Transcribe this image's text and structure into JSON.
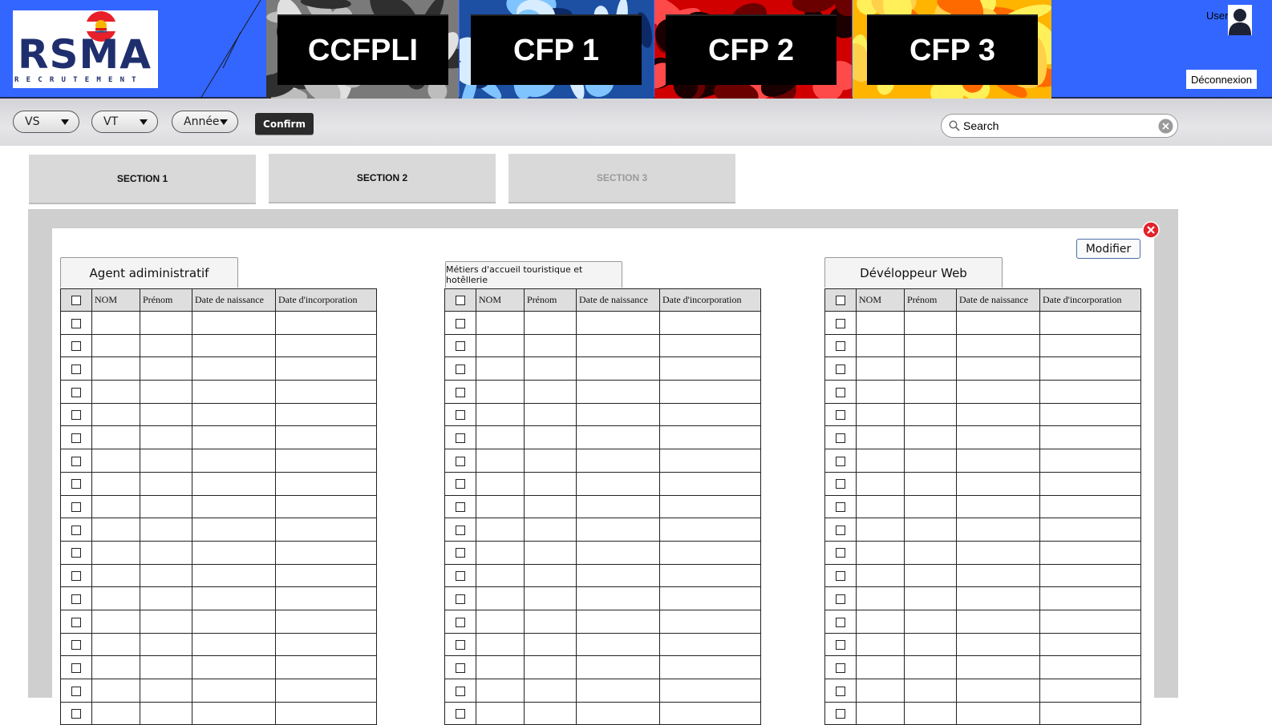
{
  "header": {
    "logo": {
      "text": "RSMA",
      "subtitle": "RECRUTEMENT"
    },
    "tiles": [
      {
        "label": "CCFPLI",
        "palette": [
          "#7a7a7a",
          "#bdbdbd",
          "#2f2f2f",
          "#e0e0e0"
        ]
      },
      {
        "label": "CFP 1",
        "palette": [
          "#1d4fa3",
          "#7fc4ff",
          "#0d2a66",
          "#d7ecff"
        ]
      },
      {
        "label": "CFP 2",
        "palette": [
          "#d10000",
          "#6b0000",
          "#ff4a4a",
          "#1a0000"
        ]
      },
      {
        "label": "CFP 3",
        "palette": [
          "#ffb400",
          "#ff6a00",
          "#fff05a",
          "#ffd04a"
        ]
      }
    ],
    "user": {
      "name": "User",
      "logout_label": "Déconnexion"
    }
  },
  "toolbar": {
    "dropdowns": [
      {
        "label": "VS"
      },
      {
        "label": "VT"
      },
      {
        "label": "Année"
      }
    ],
    "confirm_label": "Confirm",
    "search": {
      "placeholder": "Search"
    }
  },
  "sections": [
    {
      "label": "SECTION 1",
      "state": "normal"
    },
    {
      "label": "SECTION 2",
      "state": "normal"
    },
    {
      "label": "SECTION 3",
      "state": "disabled"
    }
  ],
  "panel": {
    "modify_label": "Modifier",
    "columns": [
      "NOM",
      "Prénom",
      "Date de naissance",
      "Date d'incorporation"
    ],
    "tables": [
      {
        "title": "Agent adiministratif",
        "visible_rows": 18
      },
      {
        "title": "Métiers d'accueil touristique et hotêllerie",
        "visible_rows": 18
      },
      {
        "title": "Dévéloppeur Web",
        "visible_rows": 18
      }
    ]
  },
  "colors": {
    "header_bg": "#3366ff",
    "logo_navy": "#1f2f6e",
    "panel_gray": "#cfcfcf",
    "tab_gray": "#d9d9d9",
    "close_red": "#e0242a"
  },
  "icons": [
    "user-avatar-icon",
    "search-icon",
    "clear-search-icon",
    "close-icon",
    "chevron-down-icon",
    "checkbox-icon"
  ]
}
